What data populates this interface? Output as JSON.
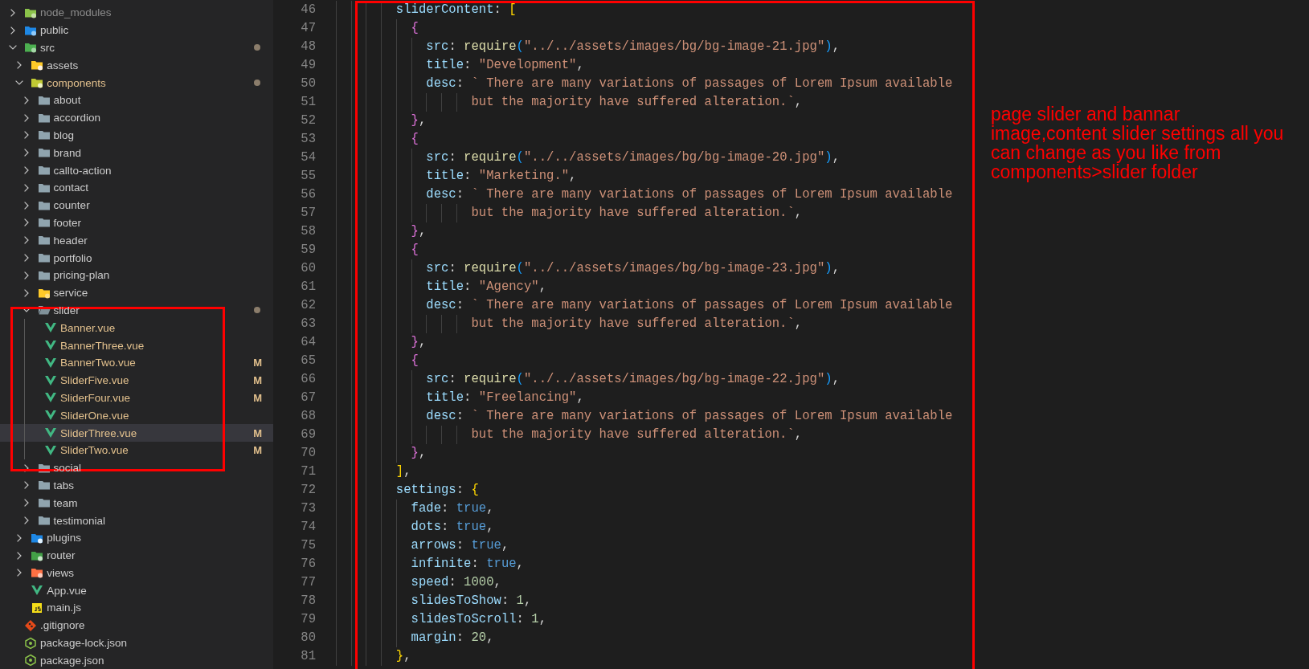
{
  "explorer": {
    "items": [
      {
        "name": "node_modules",
        "kind": "node",
        "expanded": false,
        "selected": false,
        "ignored": true,
        "modified": false,
        "changes": false
      },
      {
        "name": "public",
        "kind": "public",
        "expanded": false,
        "selected": false,
        "ignored": false,
        "modified": false,
        "changes": false
      },
      {
        "name": "src",
        "kind": "src",
        "expanded": true,
        "selected": false,
        "ignored": false,
        "modified": false,
        "changes": true,
        "children": [
          {
            "name": "assets",
            "kind": "assets",
            "expanded": false,
            "selected": false,
            "ignored": false,
            "modified": false,
            "changes": false
          },
          {
            "name": "components",
            "kind": "components",
            "expanded": true,
            "selected": false,
            "ignored": false,
            "modified": true,
            "changes": true,
            "children": [
              {
                "name": "about",
                "kind": "folder",
                "expanded": false,
                "selected": false,
                "ignored": false,
                "modified": false,
                "changes": false
              },
              {
                "name": "accordion",
                "kind": "folder",
                "expanded": false,
                "selected": false,
                "ignored": false,
                "modified": false,
                "changes": false
              },
              {
                "name": "blog",
                "kind": "folder",
                "expanded": false,
                "selected": false,
                "ignored": false,
                "modified": false,
                "changes": false
              },
              {
                "name": "brand",
                "kind": "folder",
                "expanded": false,
                "selected": false,
                "ignored": false,
                "modified": false,
                "changes": false
              },
              {
                "name": "callto-action",
                "kind": "folder",
                "expanded": false,
                "selected": false,
                "ignored": false,
                "modified": false,
                "changes": false
              },
              {
                "name": "contact",
                "kind": "folder",
                "expanded": false,
                "selected": false,
                "ignored": false,
                "modified": false,
                "changes": false
              },
              {
                "name": "counter",
                "kind": "folder",
                "expanded": false,
                "selected": false,
                "ignored": false,
                "modified": false,
                "changes": false
              },
              {
                "name": "footer",
                "kind": "folder",
                "expanded": false,
                "selected": false,
                "ignored": false,
                "modified": false,
                "changes": false
              },
              {
                "name": "header",
                "kind": "folder",
                "expanded": false,
                "selected": false,
                "ignored": false,
                "modified": false,
                "changes": false
              },
              {
                "name": "portfolio",
                "kind": "folder",
                "expanded": false,
                "selected": false,
                "ignored": false,
                "modified": false,
                "changes": false
              },
              {
                "name": "pricing-plan",
                "kind": "folder",
                "expanded": false,
                "selected": false,
                "ignored": false,
                "modified": false,
                "changes": false
              },
              {
                "name": "service",
                "kind": "service",
                "expanded": false,
                "selected": false,
                "ignored": false,
                "modified": false,
                "changes": false
              },
              {
                "name": "slider",
                "kind": "folder",
                "expanded": true,
                "selected": false,
                "ignored": false,
                "modified": false,
                "changes": true,
                "children": [
                  {
                    "name": "Banner.vue",
                    "kind": "vue",
                    "selected": false,
                    "ignored": false,
                    "modified": true,
                    "changes": false
                  },
                  {
                    "name": "BannerThree.vue",
                    "kind": "vue",
                    "selected": false,
                    "ignored": false,
                    "modified": true,
                    "changes": false
                  },
                  {
                    "name": "BannerTwo.vue",
                    "kind": "vue",
                    "selected": false,
                    "ignored": false,
                    "modified": true,
                    "changes": false,
                    "badge": "M"
                  },
                  {
                    "name": "SliderFive.vue",
                    "kind": "vue",
                    "selected": false,
                    "ignored": false,
                    "modified": true,
                    "changes": false,
                    "badge": "M"
                  },
                  {
                    "name": "SliderFour.vue",
                    "kind": "vue",
                    "selected": false,
                    "ignored": false,
                    "modified": true,
                    "changes": false,
                    "badge": "M"
                  },
                  {
                    "name": "SliderOne.vue",
                    "kind": "vue",
                    "selected": false,
                    "ignored": false,
                    "modified": true,
                    "changes": false
                  },
                  {
                    "name": "SliderThree.vue",
                    "kind": "vue",
                    "selected": true,
                    "ignored": false,
                    "modified": true,
                    "changes": false,
                    "badge": "M"
                  },
                  {
                    "name": "SliderTwo.vue",
                    "kind": "vue",
                    "selected": false,
                    "ignored": false,
                    "modified": true,
                    "changes": false,
                    "badge": "M"
                  }
                ]
              },
              {
                "name": "social",
                "kind": "folder",
                "expanded": false,
                "selected": false,
                "ignored": false,
                "modified": false,
                "changes": false
              },
              {
                "name": "tabs",
                "kind": "folder",
                "expanded": false,
                "selected": false,
                "ignored": false,
                "modified": false,
                "changes": false
              },
              {
                "name": "team",
                "kind": "folder",
                "expanded": false,
                "selected": false,
                "ignored": false,
                "modified": false,
                "changes": false
              },
              {
                "name": "testimonial",
                "kind": "folder",
                "expanded": false,
                "selected": false,
                "ignored": false,
                "modified": false,
                "changes": false
              }
            ]
          },
          {
            "name": "plugins",
            "kind": "plugins",
            "expanded": false,
            "selected": false,
            "ignored": false,
            "modified": false,
            "changes": false
          },
          {
            "name": "router",
            "kind": "router",
            "expanded": false,
            "selected": false,
            "ignored": false,
            "modified": false,
            "changes": false
          },
          {
            "name": "views",
            "kind": "views",
            "expanded": false,
            "selected": false,
            "ignored": false,
            "modified": false,
            "changes": false
          },
          {
            "name": "App.vue",
            "kind": "vue",
            "selected": false,
            "ignored": false,
            "modified": false,
            "changes": false
          },
          {
            "name": "main.js",
            "kind": "js",
            "selected": false,
            "ignored": false,
            "modified": false,
            "changes": false
          }
        ]
      },
      {
        "name": ".gitignore",
        "kind": "git",
        "selected": false,
        "ignored": false,
        "modified": false,
        "changes": false
      },
      {
        "name": "package-lock.json",
        "kind": "json",
        "selected": false,
        "ignored": false,
        "modified": false,
        "changes": false
      },
      {
        "name": "package.json",
        "kind": "json",
        "selected": false,
        "ignored": false,
        "modified": false,
        "changes": false
      }
    ]
  },
  "editor": {
    "lines": [
      {
        "number": "46",
        "tokens": [
          {
            "text": "        sliderContent",
            "kind": "prop"
          },
          {
            "text": ": ",
            "kind": "punct"
          },
          {
            "text": "[",
            "kind": "bracket1"
          }
        ]
      },
      {
        "number": "47",
        "tokens": [
          {
            "text": "          {",
            "kind": "bracket2"
          }
        ]
      },
      {
        "number": "48",
        "tokens": [
          {
            "text": "            src",
            "kind": "prop"
          },
          {
            "text": ": ",
            "kind": "punct"
          },
          {
            "text": "require",
            "kind": "func"
          },
          {
            "text": "(",
            "kind": "bracket3"
          },
          {
            "text": "\"../../assets/images/bg/bg-image-21.jpg\"",
            "kind": "string"
          },
          {
            "text": ")",
            "kind": "bracket3"
          },
          {
            "text": ",",
            "kind": "punct"
          }
        ]
      },
      {
        "number": "49",
        "tokens": [
          {
            "text": "            title",
            "kind": "prop"
          },
          {
            "text": ": ",
            "kind": "punct"
          },
          {
            "text": "\"Development\"",
            "kind": "string"
          },
          {
            "text": ",",
            "kind": "punct"
          }
        ]
      },
      {
        "number": "50",
        "tokens": [
          {
            "text": "            desc",
            "kind": "prop"
          },
          {
            "text": ": ",
            "kind": "punct"
          },
          {
            "text": "` There are many variations of passages of Lorem Ipsum available",
            "kind": "string"
          }
        ]
      },
      {
        "number": "51",
        "tokens": [
          {
            "text": "                  but the majority have suffered alteration.`",
            "kind": "string"
          },
          {
            "text": ",",
            "kind": "punct"
          }
        ]
      },
      {
        "number": "52",
        "tokens": [
          {
            "text": "          }",
            "kind": "bracket2"
          },
          {
            "text": ",",
            "kind": "punct"
          }
        ]
      },
      {
        "number": "53",
        "tokens": [
          {
            "text": "          {",
            "kind": "bracket2"
          }
        ]
      },
      {
        "number": "54",
        "tokens": [
          {
            "text": "            src",
            "kind": "prop"
          },
          {
            "text": ": ",
            "kind": "punct"
          },
          {
            "text": "require",
            "kind": "func"
          },
          {
            "text": "(",
            "kind": "bracket3"
          },
          {
            "text": "\"../../assets/images/bg/bg-image-20.jpg\"",
            "kind": "string"
          },
          {
            "text": ")",
            "kind": "bracket3"
          },
          {
            "text": ",",
            "kind": "punct"
          }
        ]
      },
      {
        "number": "55",
        "tokens": [
          {
            "text": "            title",
            "kind": "prop"
          },
          {
            "text": ": ",
            "kind": "punct"
          },
          {
            "text": "\"Marketing.\"",
            "kind": "string"
          },
          {
            "text": ",",
            "kind": "punct"
          }
        ]
      },
      {
        "number": "56",
        "tokens": [
          {
            "text": "            desc",
            "kind": "prop"
          },
          {
            "text": ": ",
            "kind": "punct"
          },
          {
            "text": "` There are many variations of passages of Lorem Ipsum available",
            "kind": "string"
          }
        ]
      },
      {
        "number": "57",
        "tokens": [
          {
            "text": "                  but the majority have suffered alteration.`",
            "kind": "string"
          },
          {
            "text": ",",
            "kind": "punct"
          }
        ]
      },
      {
        "number": "58",
        "tokens": [
          {
            "text": "          }",
            "kind": "bracket2"
          },
          {
            "text": ",",
            "kind": "punct"
          }
        ]
      },
      {
        "number": "59",
        "tokens": [
          {
            "text": "          {",
            "kind": "bracket2"
          }
        ]
      },
      {
        "number": "60",
        "tokens": [
          {
            "text": "            src",
            "kind": "prop"
          },
          {
            "text": ": ",
            "kind": "punct"
          },
          {
            "text": "require",
            "kind": "func"
          },
          {
            "text": "(",
            "kind": "bracket3"
          },
          {
            "text": "\"../../assets/images/bg/bg-image-23.jpg\"",
            "kind": "string"
          },
          {
            "text": ")",
            "kind": "bracket3"
          },
          {
            "text": ",",
            "kind": "punct"
          }
        ]
      },
      {
        "number": "61",
        "tokens": [
          {
            "text": "            title",
            "kind": "prop"
          },
          {
            "text": ": ",
            "kind": "punct"
          },
          {
            "text": "\"Agency\"",
            "kind": "string"
          },
          {
            "text": ",",
            "kind": "punct"
          }
        ]
      },
      {
        "number": "62",
        "tokens": [
          {
            "text": "            desc",
            "kind": "prop"
          },
          {
            "text": ": ",
            "kind": "punct"
          },
          {
            "text": "` There are many variations of passages of Lorem Ipsum available",
            "kind": "string"
          }
        ]
      },
      {
        "number": "63",
        "tokens": [
          {
            "text": "                  but the majority have suffered alteration.`",
            "kind": "string"
          },
          {
            "text": ",",
            "kind": "punct"
          }
        ]
      },
      {
        "number": "64",
        "tokens": [
          {
            "text": "          }",
            "kind": "bracket2"
          },
          {
            "text": ",",
            "kind": "punct"
          }
        ]
      },
      {
        "number": "65",
        "tokens": [
          {
            "text": "          {",
            "kind": "bracket2"
          }
        ]
      },
      {
        "number": "66",
        "tokens": [
          {
            "text": "            src",
            "kind": "prop"
          },
          {
            "text": ": ",
            "kind": "punct"
          },
          {
            "text": "require",
            "kind": "func"
          },
          {
            "text": "(",
            "kind": "bracket3"
          },
          {
            "text": "\"../../assets/images/bg/bg-image-22.jpg\"",
            "kind": "string"
          },
          {
            "text": ")",
            "kind": "bracket3"
          },
          {
            "text": ",",
            "kind": "punct"
          }
        ]
      },
      {
        "number": "67",
        "tokens": [
          {
            "text": "            title",
            "kind": "prop"
          },
          {
            "text": ": ",
            "kind": "punct"
          },
          {
            "text": "\"Freelancing\"",
            "kind": "string"
          },
          {
            "text": ",",
            "kind": "punct"
          }
        ]
      },
      {
        "number": "68",
        "tokens": [
          {
            "text": "            desc",
            "kind": "prop"
          },
          {
            "text": ": ",
            "kind": "punct"
          },
          {
            "text": "` There are many variations of passages of Lorem Ipsum available",
            "kind": "string"
          }
        ]
      },
      {
        "number": "69",
        "tokens": [
          {
            "text": "                  but the majority have suffered alteration.`",
            "kind": "string"
          },
          {
            "text": ",",
            "kind": "punct"
          }
        ]
      },
      {
        "number": "70",
        "tokens": [
          {
            "text": "          }",
            "kind": "bracket2"
          },
          {
            "text": ",",
            "kind": "punct"
          }
        ]
      },
      {
        "number": "71",
        "tokens": [
          {
            "text": "        ]",
            "kind": "bracket1"
          },
          {
            "text": ",",
            "kind": "punct"
          }
        ]
      },
      {
        "number": "72",
        "tokens": [
          {
            "text": "        settings",
            "kind": "prop"
          },
          {
            "text": ": ",
            "kind": "punct"
          },
          {
            "text": "{",
            "kind": "bracket1"
          }
        ]
      },
      {
        "number": "73",
        "tokens": [
          {
            "text": "          fade",
            "kind": "prop"
          },
          {
            "text": ": ",
            "kind": "punct"
          },
          {
            "text": "true",
            "kind": "bool"
          },
          {
            "text": ",",
            "kind": "punct"
          }
        ]
      },
      {
        "number": "74",
        "tokens": [
          {
            "text": "          dots",
            "kind": "prop"
          },
          {
            "text": ": ",
            "kind": "punct"
          },
          {
            "text": "true",
            "kind": "bool"
          },
          {
            "text": ",",
            "kind": "punct"
          }
        ]
      },
      {
        "number": "75",
        "tokens": [
          {
            "text": "          arrows",
            "kind": "prop"
          },
          {
            "text": ": ",
            "kind": "punct"
          },
          {
            "text": "true",
            "kind": "bool"
          },
          {
            "text": ",",
            "kind": "punct"
          }
        ]
      },
      {
        "number": "76",
        "tokens": [
          {
            "text": "          infinite",
            "kind": "prop"
          },
          {
            "text": ": ",
            "kind": "punct"
          },
          {
            "text": "true",
            "kind": "bool"
          },
          {
            "text": ",",
            "kind": "punct"
          }
        ]
      },
      {
        "number": "77",
        "tokens": [
          {
            "text": "          speed",
            "kind": "prop"
          },
          {
            "text": ": ",
            "kind": "punct"
          },
          {
            "text": "1000",
            "kind": "number"
          },
          {
            "text": ",",
            "kind": "punct"
          }
        ]
      },
      {
        "number": "78",
        "tokens": [
          {
            "text": "          slidesToShow",
            "kind": "prop"
          },
          {
            "text": ": ",
            "kind": "punct"
          },
          {
            "text": "1",
            "kind": "number"
          },
          {
            "text": ",",
            "kind": "punct"
          }
        ]
      },
      {
        "number": "79",
        "tokens": [
          {
            "text": "          slidesToScroll",
            "kind": "prop"
          },
          {
            "text": ": ",
            "kind": "punct"
          },
          {
            "text": "1",
            "kind": "number"
          },
          {
            "text": ",",
            "kind": "punct"
          }
        ]
      },
      {
        "number": "80",
        "tokens": [
          {
            "text": "          margin",
            "kind": "prop"
          },
          {
            "text": ": ",
            "kind": "punct"
          },
          {
            "text": "20",
            "kind": "number"
          },
          {
            "text": ",",
            "kind": "punct"
          }
        ]
      },
      {
        "number": "81",
        "tokens": [
          {
            "text": "        }",
            "kind": "bracket1"
          },
          {
            "text": ",",
            "kind": "punct"
          }
        ]
      }
    ]
  },
  "annotation": {
    "text": "page slider and bannar image,content slider settings all you can change as you like from components>slider folder"
  }
}
